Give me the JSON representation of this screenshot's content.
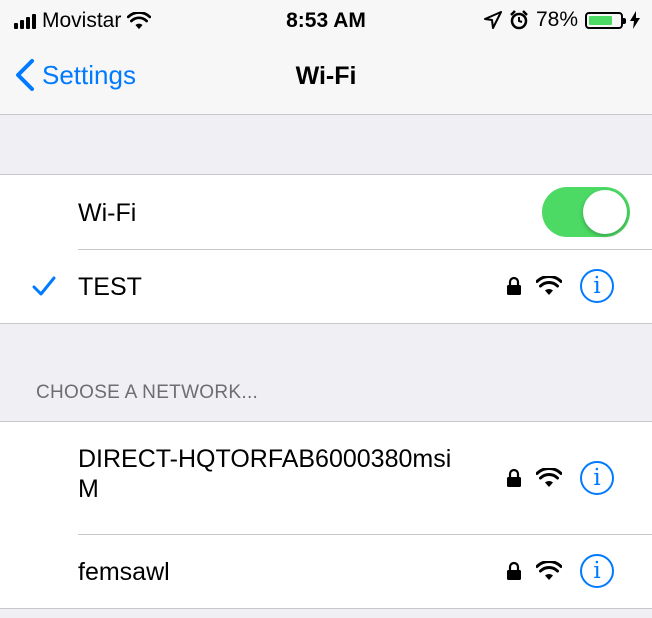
{
  "status_bar": {
    "carrier": "Movistar",
    "time": "8:53 AM",
    "battery_percent": "78%",
    "battery_level": 0.78,
    "icons": [
      "signal-icon",
      "wifi-icon",
      "location-icon",
      "alarm-icon",
      "battery-icon",
      "charging-icon"
    ]
  },
  "nav": {
    "back_label": "Settings",
    "title": "Wi-Fi"
  },
  "wifi_toggle": {
    "label": "Wi-Fi",
    "on": true
  },
  "connected_network": {
    "name": "TEST",
    "secured": true,
    "info_glyph": "i"
  },
  "choose_network": {
    "header": "CHOOSE A NETWORK...",
    "networks": [
      {
        "name": "DIRECT-HQTORFAB6000380msiM",
        "secured": true,
        "info_glyph": "i"
      },
      {
        "name": "femsawl",
        "secured": true,
        "info_glyph": "i"
      }
    ]
  },
  "colors": {
    "accent": "#007aff",
    "toggle_on": "#4cd964",
    "background": "#efeff4",
    "separator": "#c8c7cc"
  }
}
